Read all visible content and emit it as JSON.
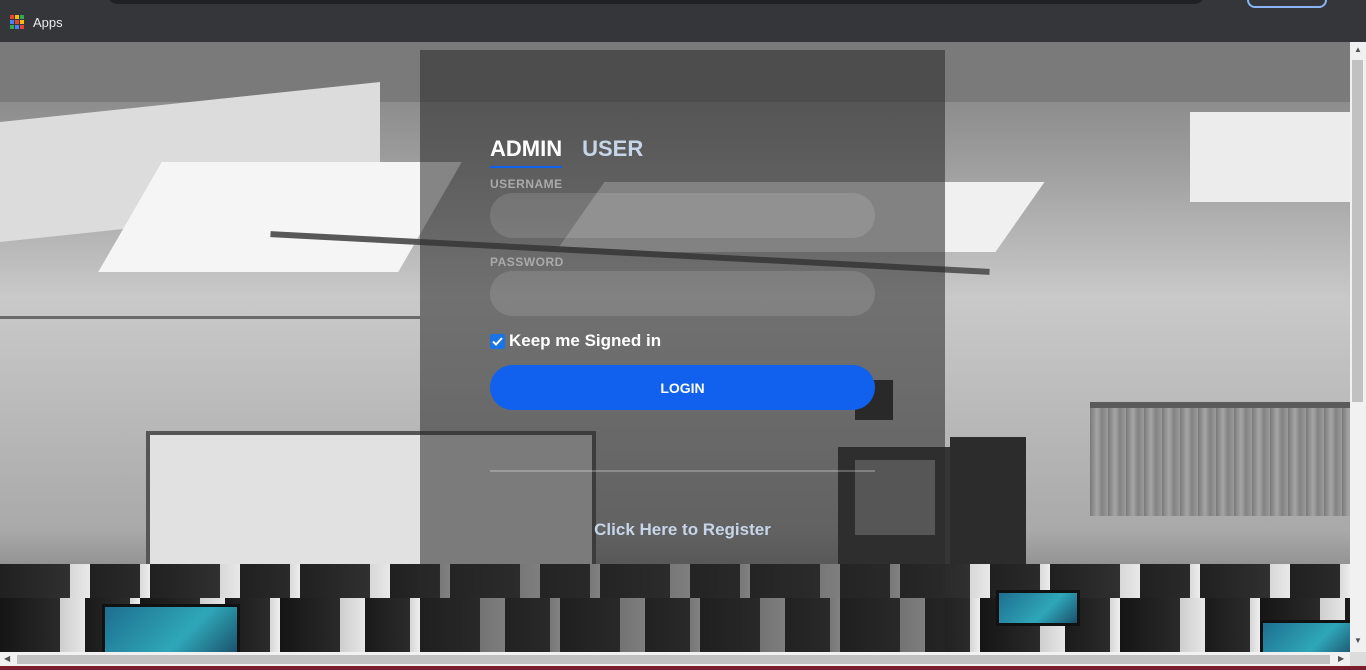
{
  "bookmarks": {
    "apps_label": "Apps"
  },
  "login": {
    "tabs": [
      {
        "label": "ADMIN"
      },
      {
        "label": "USER"
      }
    ],
    "username_label": "USERNAME",
    "username_value": "",
    "password_label": "PASSWORD",
    "password_value": "",
    "keep_signed_label": "Keep me Signed in",
    "keep_signed_checked": true,
    "login_button": "LOGIN",
    "register_link": "Click Here to Register"
  },
  "colors": {
    "accent": "#1161ee",
    "link": "#c7d5ea",
    "chrome": "#35363a"
  },
  "icons": {
    "apps": "apps-grid-icon",
    "checkbox": "checkmark-icon",
    "scroll_up": "arrow-up-icon",
    "scroll_down": "arrow-down-icon",
    "scroll_left": "arrow-left-icon",
    "scroll_right": "arrow-right-icon"
  }
}
